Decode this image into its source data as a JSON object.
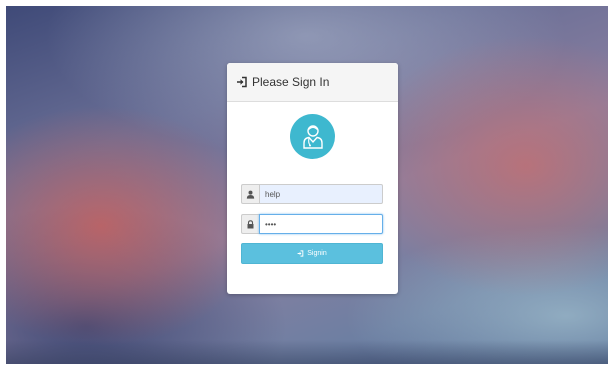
{
  "login": {
    "title": "Please Sign In",
    "username_value": "help",
    "password_value": "••••",
    "signin_label": "Signin"
  },
  "icons": {
    "header": "sign-in-icon",
    "avatar": "doctor-avatar-icon",
    "username": "user-icon",
    "password": "lock-icon",
    "button": "sign-in-icon"
  },
  "colors": {
    "accent": "#5bc0de",
    "avatar_bg": "#3eb8cf",
    "focus_border": "#66afe9"
  }
}
